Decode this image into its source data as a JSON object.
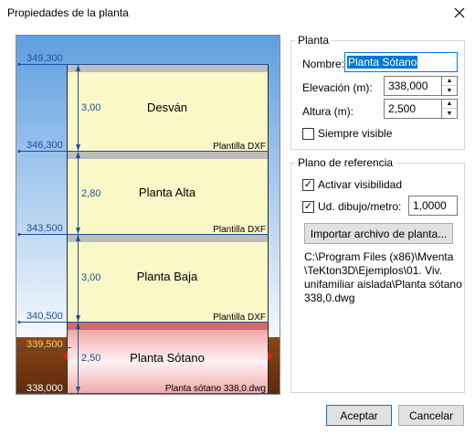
{
  "window": {
    "title": "Propiedades de la planta",
    "close_icon": "close-icon"
  },
  "diagram": {
    "elevations": [
      "349,300",
      "346,300",
      "343,500",
      "340,500",
      "339,500",
      "338,000"
    ],
    "floors": [
      {
        "name": "Desván",
        "height": "3,00",
        "template": "Plantilla DXF"
      },
      {
        "name": "Planta Alta",
        "height": "2,80",
        "template": "Plantilla DXF"
      },
      {
        "name": "Planta Baja",
        "height": "3,00",
        "template": "Plantilla DXF"
      },
      {
        "name": "Planta Sótano",
        "height": "2,50",
        "template": "Planta sótano 338,0.dwg"
      }
    ],
    "colors": {
      "sky": "#78b0e8",
      "ground": "#7a3f16",
      "floor": "#fbf8c8",
      "selected_floor": "#f6cdcd",
      "slab": "#bdbdbd",
      "selected_slab": "#d56a6a",
      "line": "#1f4f9c",
      "marker": "#e02020"
    }
  },
  "planta": {
    "legend": "Planta",
    "nombre_label": "Nombre:",
    "nombre_value": "Planta Sótano",
    "elevacion_label": "Elevación (m):",
    "elevacion_value": "338,000",
    "altura_label": "Altura (m):",
    "altura_value": "2,500",
    "siempre_visible_label": "Siempre visible",
    "siempre_visible_checked": false
  },
  "plano": {
    "legend": "Plano de referencia",
    "activar_label": "Activar visibilidad",
    "activar_checked": true,
    "ud_label": "Ud. dibujo/metro:",
    "ud_checked": true,
    "ud_value": "1,0000",
    "import_button": "Importar archivo de planta...",
    "path_lines": [
      "C:\\Program Files (x86)\\Mventa",
      "\\TeKton3D\\Ejemplos\\01. Viv.",
      "unifamiliar aislada\\Planta sótano",
      "338,0.dwg"
    ]
  },
  "buttons": {
    "accept": "Aceptar",
    "cancel": "Cancelar"
  }
}
